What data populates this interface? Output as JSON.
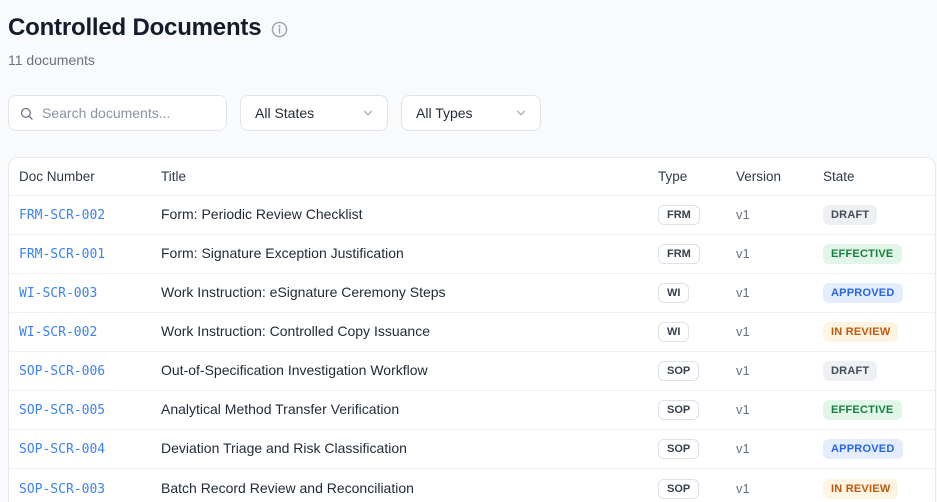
{
  "page": {
    "title": "Controlled Documents",
    "subtitle": "11 documents"
  },
  "toolbar": {
    "search_placeholder": "Search documents...",
    "state_filter_value": "All States",
    "type_filter_value": "All Types"
  },
  "table": {
    "columns": [
      "Doc Number",
      "Title",
      "Type",
      "Version",
      "State"
    ],
    "rows": [
      {
        "doc_number": "FRM-SCR-002",
        "title": "Form: Periodic Review Checklist",
        "type": "FRM",
        "version": "v1",
        "state": "DRAFT"
      },
      {
        "doc_number": "FRM-SCR-001",
        "title": "Form: Signature Exception Justification",
        "type": "FRM",
        "version": "v1",
        "state": "EFFECTIVE"
      },
      {
        "doc_number": "WI-SCR-003",
        "title": "Work Instruction: eSignature Ceremony Steps",
        "type": "WI",
        "version": "v1",
        "state": "APPROVED"
      },
      {
        "doc_number": "WI-SCR-002",
        "title": "Work Instruction: Controlled Copy Issuance",
        "type": "WI",
        "version": "v1",
        "state": "IN REVIEW"
      },
      {
        "doc_number": "SOP-SCR-006",
        "title": "Out-of-Specification Investigation Workflow",
        "type": "SOP",
        "version": "v1",
        "state": "DRAFT"
      },
      {
        "doc_number": "SOP-SCR-005",
        "title": "Analytical Method Transfer Verification",
        "type": "SOP",
        "version": "v1",
        "state": "EFFECTIVE"
      },
      {
        "doc_number": "SOP-SCR-004",
        "title": "Deviation Triage and Risk Classification",
        "type": "SOP",
        "version": "v1",
        "state": "APPROVED"
      },
      {
        "doc_number": "SOP-SCR-003",
        "title": "Batch Record Review and Reconciliation",
        "type": "SOP",
        "version": "v1",
        "state": "IN REVIEW"
      }
    ],
    "state_colors": {
      "DRAFT": {
        "bg": "#eef0f3",
        "text": "#414b5a"
      },
      "EFFECTIVE": {
        "bg": "#e2f5e9",
        "text": "#15803d"
      },
      "APPROVED": {
        "bg": "#e4edfc",
        "text": "#2563eb"
      },
      "IN REVIEW": {
        "bg": "#fdf5e1",
        "text": "#c2570e"
      }
    },
    "accent_color": "#3b82f6"
  }
}
